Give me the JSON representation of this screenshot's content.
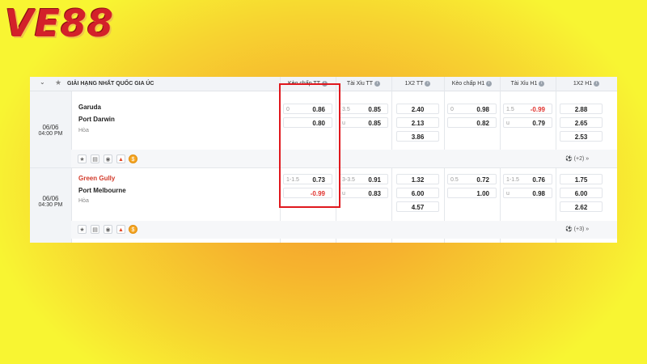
{
  "brand": {
    "logo_text": "VE88"
  },
  "league": {
    "title": "GIẢI HẠNG NHẤT QUỐC GIA ÚC"
  },
  "columns": [
    "Kèo chấp TT",
    "Tài Xỉu TT",
    "1X2 TT",
    "Kèo chấp H1",
    "Tài Xỉu H1",
    "1X2 H1"
  ],
  "matches": [
    {
      "date": "06/06",
      "time": "04:00 PM",
      "home": "Garuda",
      "away": "Port Darwin",
      "draw_label": "Hòa",
      "more": "(+2)",
      "hdp_tt": {
        "line": "0",
        "home": "0.86",
        "away": "0.80"
      },
      "ou_tt": {
        "line": "3.5",
        "sub": "u",
        "over": "0.85",
        "under": "0.85"
      },
      "x12_tt": [
        "2.40",
        "2.13",
        "3.86"
      ],
      "hdp_h1": {
        "line": "0",
        "home": "0.98",
        "away": "0.82"
      },
      "ou_h1": {
        "line": "1.5",
        "sub": "u",
        "over": "-0.99",
        "under": "0.79"
      },
      "x12_h1": [
        "2.88",
        "2.65",
        "2.53"
      ]
    },
    {
      "date": "06/06",
      "time": "04:30 PM",
      "home": "Green Gully",
      "away": "Port Melbourne",
      "draw_label": "Hòa",
      "more": "(+3)",
      "hdp_tt": {
        "line": "1-1.5",
        "home": "0.73",
        "away": "-0.99"
      },
      "ou_tt": {
        "line": "3-3.5",
        "sub": "u",
        "over": "0.91",
        "under": "0.83"
      },
      "x12_tt": [
        "1.32",
        "6.00",
        "4.57"
      ],
      "hdp_h1": {
        "line": "0.5",
        "home": "0.72",
        "away": "1.00"
      },
      "ou_h1": {
        "line": "1-1.5",
        "sub": "u",
        "over": "0.76",
        "under": "0.98"
      },
      "x12_h1": [
        "1.75",
        "6.00",
        "2.62"
      ]
    }
  ],
  "icons": [
    "star-icon",
    "stats-icon",
    "eye-icon",
    "fire-icon",
    "coin-icon"
  ],
  "accent": {
    "highlight_box": "#e0181e",
    "negative_odd": "#e0322e",
    "home_team_hot": "#d23a2a"
  }
}
